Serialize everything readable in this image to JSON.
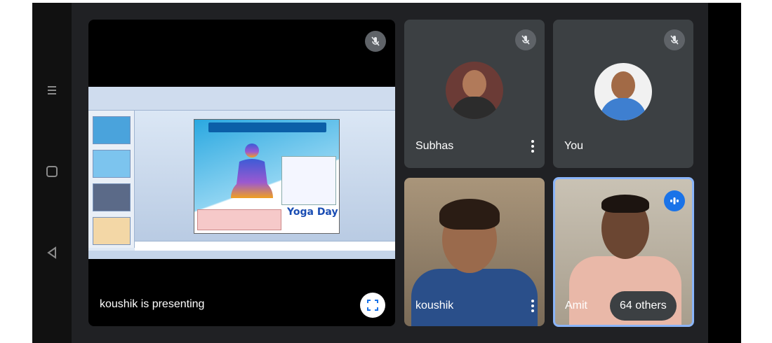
{
  "presentation": {
    "banner": "koushik is presenting",
    "slide_word": "Yoga Day"
  },
  "participants": [
    {
      "name": "Subhas",
      "muted": true
    },
    {
      "name": "You",
      "muted": true
    },
    {
      "name": "koushik",
      "muted": false
    },
    {
      "name": "Amit",
      "speaking": true
    }
  ],
  "others_chip": "64 others",
  "icons": {
    "mute": "mic-off-icon",
    "fullscreen": "fullscreen-icon",
    "more": "more-vert-icon",
    "speaking": "audio-level-icon",
    "nav_recents": "recents-icon",
    "nav_home": "home-icon",
    "nav_back": "back-icon"
  },
  "colors": {
    "background": "#202124",
    "tile": "#3c4043",
    "accent": "#1a73e8",
    "active_border": "#8ab4f8"
  }
}
